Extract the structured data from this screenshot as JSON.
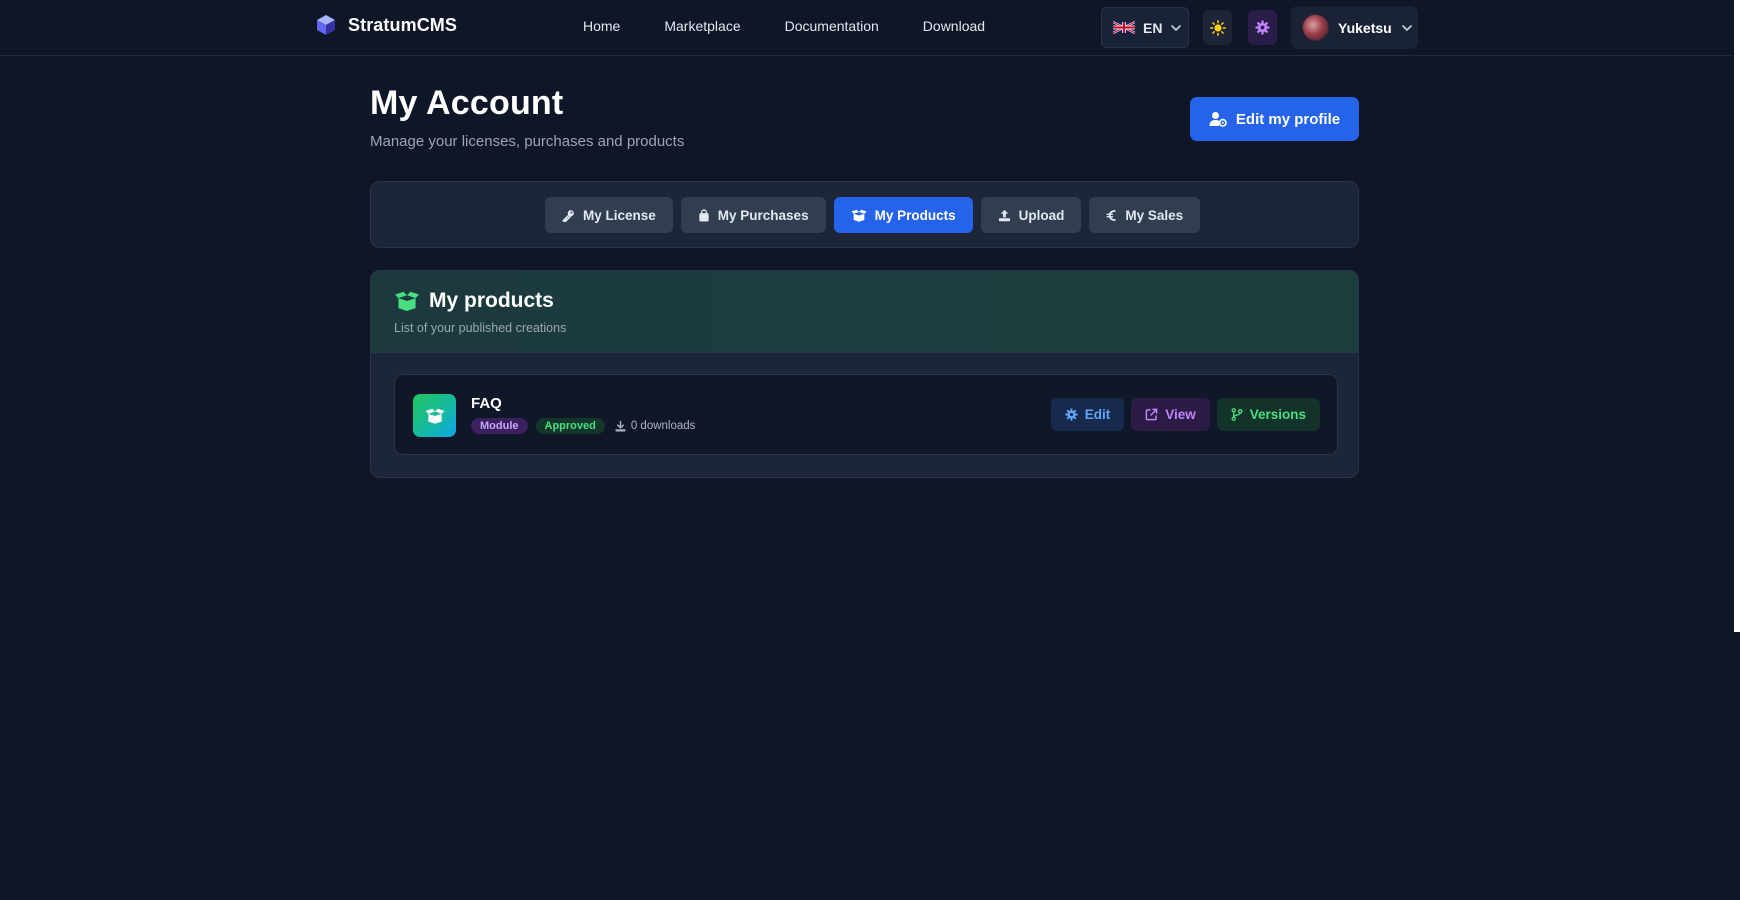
{
  "brand": {
    "name": "StratumCMS"
  },
  "nav": {
    "links": [
      "Home",
      "Marketplace",
      "Documentation",
      "Download"
    ]
  },
  "language": {
    "code": "EN"
  },
  "user": {
    "name": "Yuketsu"
  },
  "header": {
    "title": "My Account",
    "subtitle": "Manage your licenses, purchases and products",
    "edit_profile_label": "Edit my profile"
  },
  "tabs": [
    {
      "label": "My License",
      "icon": "key-icon",
      "active": false
    },
    {
      "label": "My Purchases",
      "icon": "shopping-bag-icon",
      "active": false
    },
    {
      "label": "My Products",
      "icon": "box-open-icon",
      "active": true
    },
    {
      "label": "Upload",
      "icon": "upload-icon",
      "active": false
    },
    {
      "label": "My Sales",
      "icon": "euro-icon",
      "active": false
    }
  ],
  "products_section": {
    "title": "My products",
    "subtitle": "List of your published creations",
    "items": [
      {
        "name": "FAQ",
        "type_badge": "Module",
        "status_badge": "Approved",
        "downloads": "0 downloads",
        "actions": {
          "edit": "Edit",
          "view": "View",
          "versions": "Versions"
        }
      }
    ]
  },
  "colors": {
    "background": "#0e1627",
    "accent": "#2563eb",
    "panel": "#1c2638",
    "success": "#4ade80",
    "purple": "#c084fc"
  }
}
